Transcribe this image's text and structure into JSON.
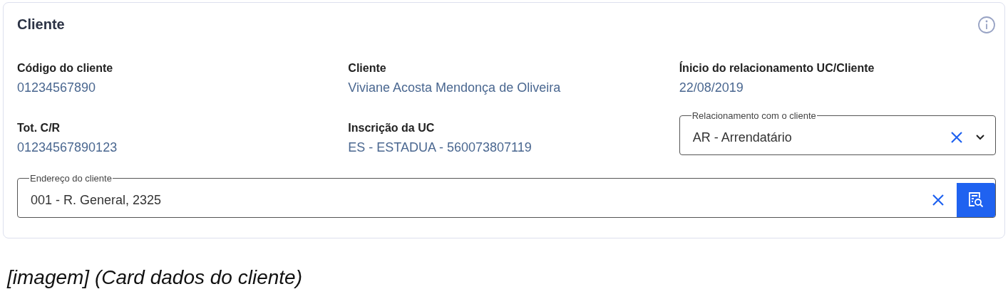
{
  "card": {
    "title": "Cliente",
    "fields": [
      {
        "label": "Código do cliente",
        "value": "01234567890"
      },
      {
        "label": "Cliente",
        "value": "Viviane Acosta Mendonça de Oliveira"
      },
      {
        "label": "Ínicio do relacionamento UC/Cliente",
        "value": "22/08/2019"
      },
      {
        "label": "Tot. C/R",
        "value": "01234567890123"
      },
      {
        "label": "Inscrição da UC",
        "value": "ES - ESTADUA - 560073807119"
      }
    ],
    "relationship_select": {
      "label": "Relacionamento com o cliente",
      "value": "AR - Arrendatário"
    },
    "address_field": {
      "label": "Endereço do cliente",
      "value": "001 - R. General, 2325"
    }
  },
  "caption": "[imagem] (Card dados do cliente)"
}
